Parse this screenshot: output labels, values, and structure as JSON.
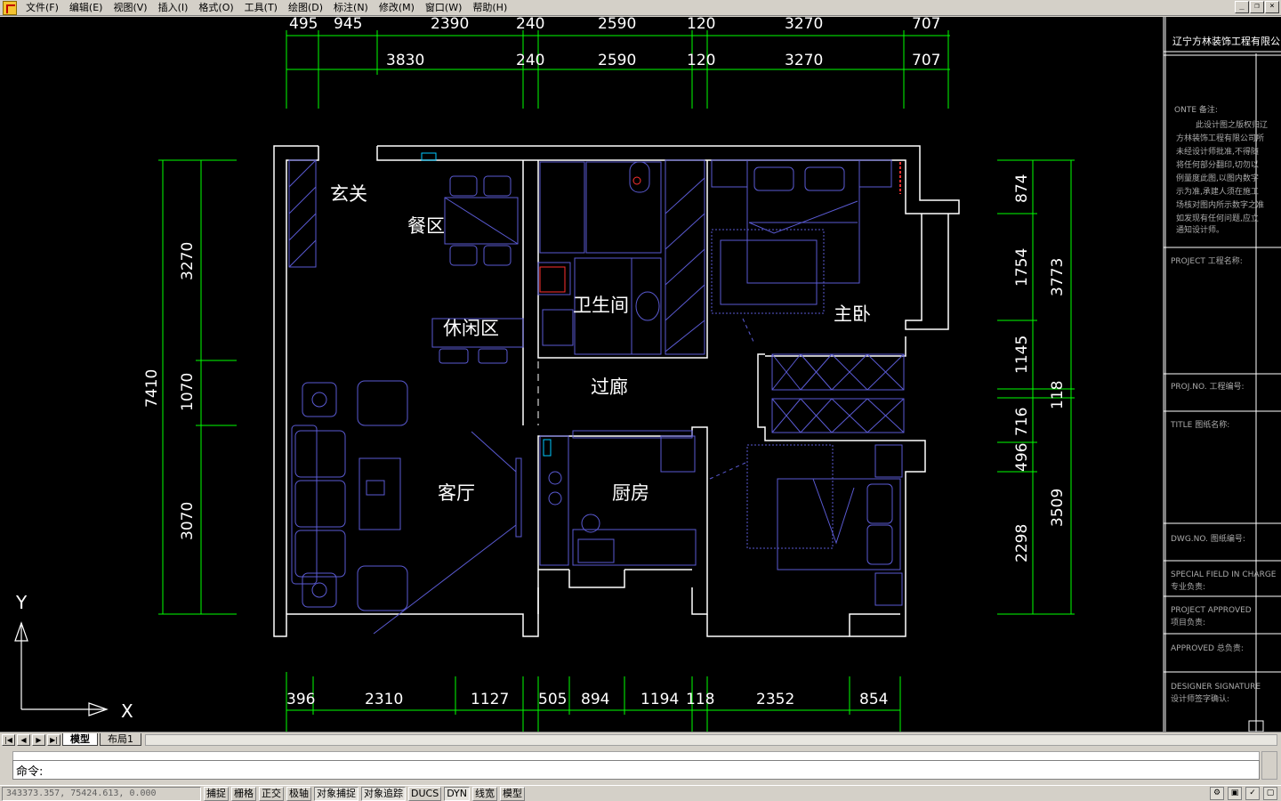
{
  "menu": [
    "文件(F)",
    "编辑(E)",
    "视图(V)",
    "插入(I)",
    "格式(O)",
    "工具(T)",
    "绘图(D)",
    "标注(N)",
    "修改(M)",
    "窗口(W)",
    "帮助(H)"
  ],
  "window_controls": [
    "_",
    "❐",
    "×"
  ],
  "drawing": {
    "dim_top_row1": [
      "495",
      "945",
      "2390",
      "240",
      "2590",
      "120",
      "3270",
      "707"
    ],
    "dim_top_row2": [
      "3830",
      "240",
      "2590",
      "120",
      "3270",
      "707"
    ],
    "dim_left_total": "7410",
    "dim_left": [
      "3270",
      "1070",
      "3070"
    ],
    "dim_right_inner": [
      "874",
      "1754",
      "1145",
      "716",
      "496",
      "2298"
    ],
    "dim_right_outer": [
      "3773",
      "118",
      "3509"
    ],
    "dim_bottom": [
      "396",
      "2310",
      "1127",
      "505",
      "894",
      "1194",
      "118",
      "2352",
      "854"
    ],
    "rooms": {
      "entry": "玄关",
      "dining": "餐区",
      "leisure": "休闲区",
      "bathroom": "卫生间",
      "master_bedroom": "主卧",
      "corridor": "过廊",
      "living": "客厅",
      "kitchen": "厨房"
    },
    "ucs": {
      "x": "X",
      "y": "Y"
    },
    "colors": {
      "wall": "#ffffff",
      "dimension": "#00ff00",
      "dimension_text": "#ffffff",
      "furniture": "#5a5ad2",
      "background": "#000000"
    }
  },
  "title_block": {
    "company": "辽宁方林装饰工程有限公",
    "note_title": "ONTE 备注:",
    "note_lines": [
      "此设计图之版权归辽",
      "方林装饰工程有限公司所",
      "未经设计师批准,不得随",
      "将任何部分翻印,切勿以",
      "例量度此图,以图内数字",
      "示为准,承建人须在施工",
      "场核对图内所示数字之准",
      "如发现有任何问题,应立",
      "通知设计师。"
    ],
    "fields": [
      "PROJECT 工程名称:",
      "PROJ.NO. 工程编号:",
      "TITLE 图纸名称:",
      "DWG.NO. 图纸编号:",
      "SPECIAL FIELD IN CHARGE",
      "专业负责:",
      "PROJECT APPROVED",
      "项目负责:",
      "APPROVED 总负责:",
      "DESIGNER SIGNATURE",
      "设计师签字确认:"
    ]
  },
  "tabs": [
    "模型",
    "布局1"
  ],
  "command": {
    "prompt": "命令:"
  },
  "status": {
    "coords": "343373.357,  75424.613,  0.000",
    "toggles": [
      "捕捉",
      "栅格",
      "正交",
      "极轴",
      "对象捕捉",
      "对象追踪",
      "DUCS",
      "DYN",
      "线宽",
      "模型"
    ]
  }
}
